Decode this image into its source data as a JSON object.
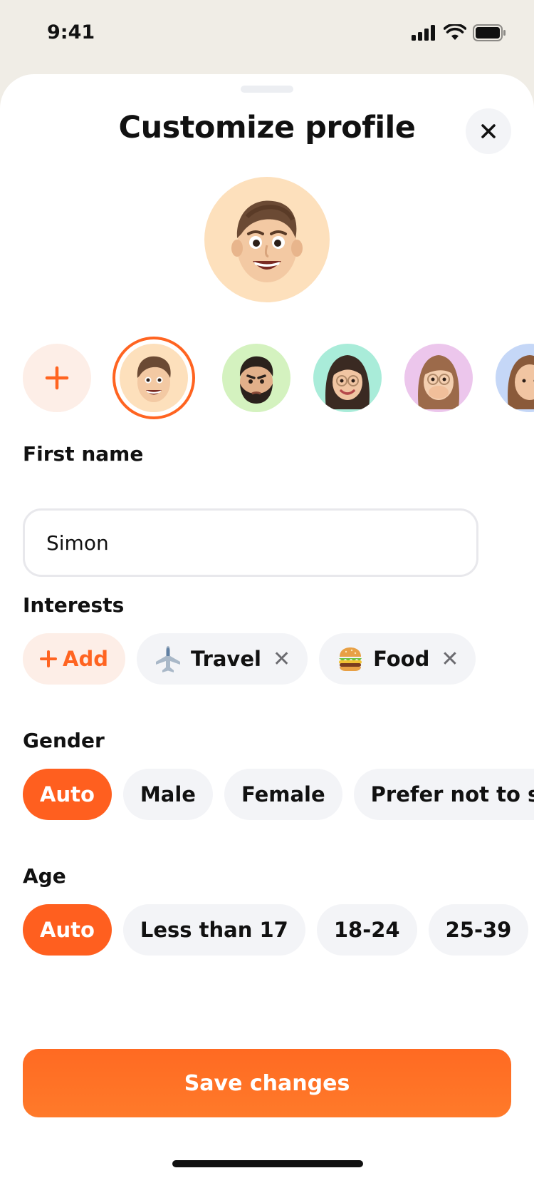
{
  "status": {
    "time": "9:41"
  },
  "header": {
    "title": "Customize profile"
  },
  "avatars": {
    "selected_index": 0,
    "items": [
      {
        "name": "avatar-man-smiling",
        "bg": "#fde0bc"
      },
      {
        "name": "avatar-man-beard",
        "bg": "#d4f2bf"
      },
      {
        "name": "avatar-woman-glasses",
        "bg": "#a9ecd9"
      },
      {
        "name": "avatar-woman-surprised",
        "bg": "#ecc6ec"
      },
      {
        "name": "avatar-woman-partial",
        "bg": "#c5d7f7"
      }
    ]
  },
  "first_name": {
    "label": "First name",
    "value": "Simon"
  },
  "interests": {
    "label": "Interests",
    "add_label": "Add",
    "items": [
      {
        "icon": "airplane-icon",
        "label": "Travel"
      },
      {
        "icon": "burger-icon",
        "label": "Food"
      }
    ]
  },
  "gender": {
    "label": "Gender",
    "selected": "Auto",
    "options": [
      "Auto",
      "Male",
      "Female",
      "Prefer not to say"
    ]
  },
  "age": {
    "label": "Age",
    "selected": "Auto",
    "options": [
      "Auto",
      "Less than 17",
      "18-24",
      "25-39",
      ""
    ]
  },
  "save_label": "Save changes",
  "colors": {
    "accent": "#ff5f1f",
    "chip_bg": "#f3f4f7",
    "accent_soft": "#fdeee7"
  }
}
